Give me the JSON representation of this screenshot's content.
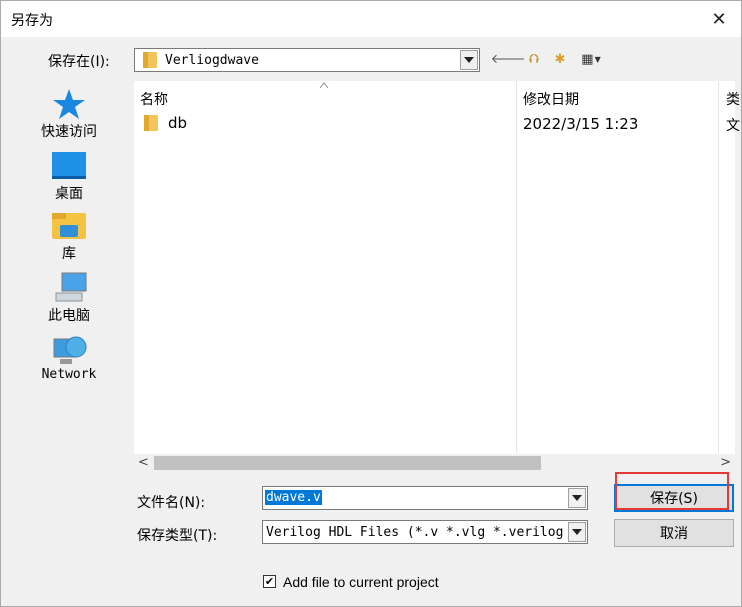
{
  "window": {
    "title": "另存为",
    "close_glyph": "✕"
  },
  "save_in": {
    "label": "保存在(I):",
    "value": "Verliogdwave"
  },
  "toolbar": {
    "back_glyph": "🡐",
    "up_glyph": "⮉",
    "new_folder_glyph": "✱",
    "view_glyph": "▦"
  },
  "places": [
    {
      "label": "快速访问",
      "icon": "star-icon"
    },
    {
      "label": "桌面",
      "icon": "desktop-icon"
    },
    {
      "label": "库",
      "icon": "library-icon"
    },
    {
      "label": "此电脑",
      "icon": "computer-icon"
    },
    {
      "label": "Network",
      "icon": "network-icon"
    }
  ],
  "file_list": {
    "columns": [
      {
        "label": "名称"
      },
      {
        "label": "修改日期"
      },
      {
        "label": "类"
      }
    ],
    "rows": [
      {
        "name": "db",
        "modified": "2022/3/15 1:23",
        "type": "文"
      }
    ]
  },
  "filename": {
    "label": "文件名(N):",
    "value": "dwave.v"
  },
  "filetype": {
    "label": "保存类型(T):",
    "value": "Verilog HDL Files (*.v *.vlg *.verilog"
  },
  "buttons": {
    "save": "保存(S)",
    "cancel": "取消"
  },
  "add_to_project": {
    "label": "Add file to current project",
    "checked": true
  },
  "colors": {
    "accent": "#0078d7",
    "highlight_box": "#e53935"
  }
}
